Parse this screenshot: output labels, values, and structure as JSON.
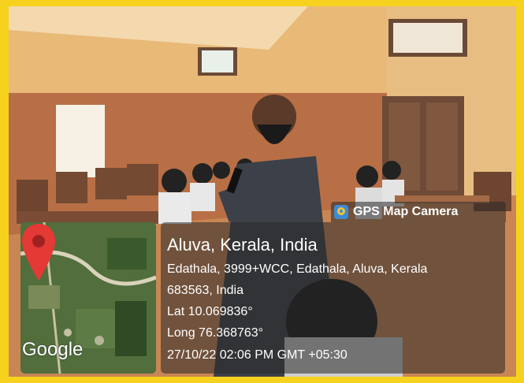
{
  "gps_badge": {
    "label": "GPS Map Camera",
    "icon": "gps-map-camera-app-icon"
  },
  "location": {
    "place": "Aluva, Kerala, India",
    "address_line1": "Edathala, 3999+WCC, Edathala, Aluva, Kerala",
    "address_line2": "683563, India",
    "latitude": "Lat 10.069836°",
    "longitude": "Long 76.368763°",
    "timestamp": "27/10/22 02:06 PM GMT +05:30"
  },
  "map": {
    "provider_logo": "Google",
    "pin_icon": "map-pin-icon"
  },
  "colors": {
    "frame": "#f6d21e",
    "pin": "#e53935",
    "overlay": "#282828"
  }
}
